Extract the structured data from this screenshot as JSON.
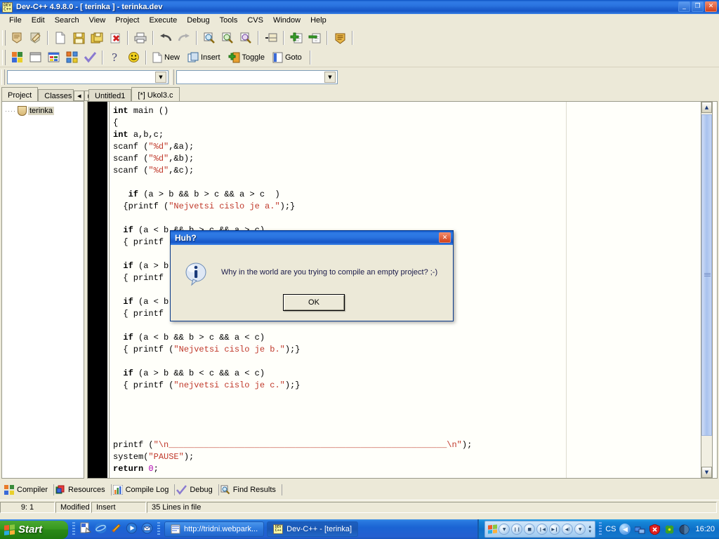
{
  "window": {
    "title": "Dev-C++ 4.9.8.0  -  [ terinka ] - terinka.dev",
    "app_icon": "devcpp-icon",
    "buttons": {
      "minimize": "_",
      "restore": "❐",
      "close": "✕"
    }
  },
  "menu": {
    "items": [
      "File",
      "Edit",
      "Search",
      "View",
      "Project",
      "Execute",
      "Debug",
      "Tools",
      "CVS",
      "Window",
      "Help"
    ]
  },
  "toolbar1": {
    "buttons": [
      {
        "name": "new-project-icon",
        "glyph": "🛡"
      },
      {
        "name": "open-project-icon",
        "glyph": "🛡"
      },
      {
        "name": "new-file-icon",
        "glyph": "▯"
      },
      {
        "name": "save-icon",
        "glyph": "▤"
      },
      {
        "name": "save-all-icon",
        "glyph": "▦"
      },
      {
        "name": "close-icon",
        "glyph": "✻"
      },
      {
        "name": "print-icon",
        "glyph": "▤"
      },
      {
        "name": "undo-icon",
        "glyph": "↰"
      },
      {
        "name": "redo-icon",
        "glyph": "↱"
      },
      {
        "name": "find-icon",
        "glyph": "🔍"
      },
      {
        "name": "find-next-icon",
        "glyph": "🔍"
      },
      {
        "name": "replace-icon",
        "glyph": "🔍"
      },
      {
        "name": "goto-line-icon",
        "glyph": "▸▤"
      },
      {
        "name": "add-to-project-icon",
        "glyph": "✚"
      },
      {
        "name": "remove-from-project-icon",
        "glyph": "✖"
      },
      {
        "name": "project-options-icon",
        "glyph": "▤"
      }
    ]
  },
  "toolbar2": {
    "buttons": [
      {
        "name": "compile-icon",
        "glyph": "▩"
      },
      {
        "name": "run-icon",
        "glyph": "▭"
      },
      {
        "name": "compile-and-run-icon",
        "glyph": "▩"
      },
      {
        "name": "rebuild-all-icon",
        "glyph": "▩"
      },
      {
        "name": "debug-icon",
        "glyph": "✓"
      },
      {
        "name": "help-icon",
        "glyph": "?"
      },
      {
        "name": "about-icon",
        "glyph": "☺"
      }
    ],
    "labeled": [
      {
        "name": "new-bookmark-button",
        "label": "New",
        "glyph": "▯"
      },
      {
        "name": "insert-button",
        "label": "Insert",
        "glyph": "▣"
      },
      {
        "name": "toggle-button",
        "label": "Toggle",
        "glyph": "✚"
      },
      {
        "name": "goto-button",
        "label": "Goto",
        "glyph": "▮"
      }
    ]
  },
  "combos": {
    "left_value": "",
    "right_value": ""
  },
  "left_panel": {
    "tabs": [
      {
        "label": "Project",
        "active": true
      },
      {
        "label": "Classes",
        "active": false
      }
    ],
    "nav": {
      "prev": "◀",
      "next": "▶"
    },
    "tree": {
      "root_label": "terinka",
      "icon": "project-node-icon"
    }
  },
  "editor": {
    "tabs": [
      {
        "label": "Untitled1",
        "active": false
      },
      {
        "label": "[*] Ukol3.c",
        "active": true
      }
    ],
    "code_lines": [
      [
        {
          "t": "int ",
          "c": "kw"
        },
        {
          "t": "main ()",
          "c": ""
        }
      ],
      [
        {
          "t": "{",
          "c": ""
        }
      ],
      [
        {
          "t": "int ",
          "c": "kw"
        },
        {
          "t": "a,b,c;",
          "c": ""
        }
      ],
      [
        {
          "t": "scanf (",
          "c": ""
        },
        {
          "t": "\"%d\"",
          "c": "str"
        },
        {
          "t": ",&a);",
          "c": ""
        }
      ],
      [
        {
          "t": "scanf (",
          "c": ""
        },
        {
          "t": "\"%d\"",
          "c": "str"
        },
        {
          "t": ",&b);",
          "c": ""
        }
      ],
      [
        {
          "t": "scanf (",
          "c": ""
        },
        {
          "t": "\"%d\"",
          "c": "str"
        },
        {
          "t": ",&c);",
          "c": ""
        }
      ],
      [
        {
          "t": "",
          "c": ""
        }
      ],
      [
        {
          "t": "   if",
          "c": "kw"
        },
        {
          "t": " (a > b && b > c && a > c  )",
          "c": ""
        }
      ],
      [
        {
          "t": "  {printf (",
          "c": ""
        },
        {
          "t": "\"Nejvetsi cislo je a.\"",
          "c": "str"
        },
        {
          "t": ");}",
          "c": ""
        }
      ],
      [
        {
          "t": "",
          "c": ""
        }
      ],
      [
        {
          "t": "  if",
          "c": "kw"
        },
        {
          "t": " (a < b && b > c && a > c)",
          "c": ""
        }
      ],
      [
        {
          "t": "  { printf (",
          "c": ""
        },
        {
          "t": "\"Nejvetsi cislo je b.\"",
          "c": "str"
        },
        {
          "t": ");}",
          "c": ""
        }
      ],
      [
        {
          "t": "",
          "c": ""
        }
      ],
      [
        {
          "t": "  if",
          "c": "kw"
        },
        {
          "t": " (a > b && b < c && a > c)",
          "c": ""
        }
      ],
      [
        {
          "t": "  { printf (",
          "c": ""
        },
        {
          "t": "\"Nejvetsi cislo je a.\"",
          "c": "str"
        },
        {
          "t": ");}",
          "c": ""
        }
      ],
      [
        {
          "t": "",
          "c": ""
        }
      ],
      [
        {
          "t": "  if",
          "c": "kw"
        },
        {
          "t": " (a < b && b < c && a < c)",
          "c": ""
        }
      ],
      [
        {
          "t": "  { printf (",
          "c": ""
        },
        {
          "t": "\"Nejvetsi cislo je c.\"",
          "c": "str"
        },
        {
          "t": ");}",
          "c": ""
        }
      ],
      [
        {
          "t": "",
          "c": ""
        }
      ],
      [
        {
          "t": "  if",
          "c": "kw"
        },
        {
          "t": " (a < b && b > c && a < c)",
          "c": ""
        }
      ],
      [
        {
          "t": "  { printf (",
          "c": ""
        },
        {
          "t": "\"Nejvetsi cislo je b.\"",
          "c": "str"
        },
        {
          "t": ");}",
          "c": ""
        }
      ],
      [
        {
          "t": "",
          "c": ""
        }
      ],
      [
        {
          "t": "  if",
          "c": "kw"
        },
        {
          "t": " (a > b && b < c && a < c)",
          "c": ""
        }
      ],
      [
        {
          "t": "  { printf (",
          "c": ""
        },
        {
          "t": "\"nejvetsi cislo je c.\"",
          "c": "str"
        },
        {
          "t": ");}",
          "c": ""
        }
      ],
      [
        {
          "t": "",
          "c": ""
        }
      ],
      [
        {
          "t": "",
          "c": ""
        }
      ],
      [
        {
          "t": "",
          "c": ""
        }
      ],
      [
        {
          "t": "",
          "c": ""
        }
      ],
      [
        {
          "t": "printf (",
          "c": ""
        },
        {
          "t": "\"\\n_______________________________________________________\\n\"",
          "c": "str"
        },
        {
          "t": ");",
          "c": ""
        }
      ],
      [
        {
          "t": "system(",
          "c": ""
        },
        {
          "t": "\"PAUSE\"",
          "c": "str"
        },
        {
          "t": ");",
          "c": ""
        }
      ],
      [
        {
          "t": "return ",
          "c": "kw"
        },
        {
          "t": "0",
          "c": "num"
        },
        {
          "t": ";",
          "c": ""
        }
      ]
    ]
  },
  "bottom_tabs": [
    {
      "label": "Compiler",
      "icon": "compiler-icon"
    },
    {
      "label": "Resources",
      "icon": "resources-icon"
    },
    {
      "label": "Compile Log",
      "icon": "compile-log-icon"
    },
    {
      "label": "Debug",
      "icon": "debug-check-icon"
    },
    {
      "label": "Find Results",
      "icon": "find-results-icon"
    }
  ],
  "statusbar": {
    "cursor": "9: 1",
    "modified": "Modified",
    "insert_mode": "Insert",
    "lines": "35 Lines in file"
  },
  "dialog": {
    "title": "Huh?",
    "message": "Why in the world are you trying to compile an empty project? ;-)",
    "ok_label": "OK",
    "close_glyph": "✕",
    "icon": "info-icon"
  },
  "taskbar": {
    "start_label": "Start",
    "quicklaunch": [
      {
        "name": "show-desktop-icon"
      },
      {
        "name": "internet-explorer-icon"
      },
      {
        "name": "winamp-icon"
      },
      {
        "name": "media-player-icon"
      },
      {
        "name": "outlook-express-icon"
      }
    ],
    "tasks": [
      {
        "label": "http://tridni.webpark...",
        "icon": "browser-icon",
        "active": false
      },
      {
        "label": "Dev-C++ - [terinka]",
        "icon": "devcpp-icon",
        "active": true
      }
    ],
    "tray": {
      "language": "CS",
      "clock": "16:20",
      "icons": [
        "volume-icon",
        "network-icon",
        "antivirus-icon",
        "clover-icon",
        "ball-icon"
      ]
    },
    "deskband": {
      "buttons": [
        "menu-arrow",
        "pause",
        "stop",
        "prev-track",
        "next-track",
        "volume",
        "eq"
      ]
    }
  },
  "colors": {
    "titlebar_blue": "#1e62d0",
    "face": "#ece9d8",
    "string_red": "#c0392b",
    "number_magenta": "#b000b0",
    "taskbar_blue": "#245fd0",
    "start_green": "#2a8a17"
  }
}
